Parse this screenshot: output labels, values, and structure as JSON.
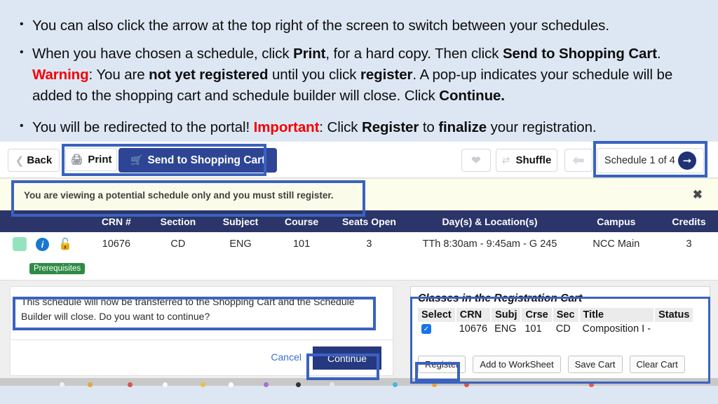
{
  "slide": {
    "background": "#dde7f3",
    "bullets": [
      {
        "id": "b1",
        "parts": [
          {
            "t": "You can also click the arrow at the top right of the screen to switch between your schedules.",
            "s": "normal"
          }
        ]
      },
      {
        "id": "b2",
        "parts": [
          {
            "t": "When you have chosen a schedule, click ",
            "s": "normal"
          },
          {
            "t": "Print",
            "s": "bold"
          },
          {
            "t": ", for a hard copy.  Then click ",
            "s": "normal"
          },
          {
            "t": "Send to Shopping Cart",
            "s": "bold"
          },
          {
            "t": ".  ",
            "s": "normal"
          },
          {
            "t": "Warning",
            "s": "red"
          },
          {
            "t": ": You are ",
            "s": "normal"
          },
          {
            "t": "not yet registered",
            "s": "bold"
          },
          {
            "t": " until you click ",
            "s": "normal"
          },
          {
            "t": "register",
            "s": "bold"
          },
          {
            "t": ".  A pop-up indicates your schedule will be added to the shopping cart and schedule builder will close. Click ",
            "s": "normal"
          },
          {
            "t": "Continue.",
            "s": "bold"
          }
        ]
      },
      {
        "id": "b3",
        "parts": [
          {
            "t": "You will be redirected to the portal!  ",
            "s": "normal"
          },
          {
            "t": "Important",
            "s": "red"
          },
          {
            "t": ":  Click ",
            "s": "normal"
          },
          {
            "t": "Register",
            "s": "bold"
          },
          {
            "t": " to ",
            "s": "normal"
          },
          {
            "t": "finalize",
            "s": "bold"
          },
          {
            "t": " your registration.",
            "s": "normal"
          }
        ]
      }
    ]
  },
  "toolbar": {
    "back_label": "Back",
    "back_icon": "chevron-left-icon",
    "print_label": "Print",
    "print_icon": "printer-icon",
    "cart_label": "Send to Shopping Cart",
    "cart_icon": "shopping-cart-icon",
    "favorite_icon": "heart-icon",
    "shuffle_label": "Shuffle",
    "shuffle_icon": "shuffle-icon",
    "prev_icon": "arrow-left-circle-icon",
    "schedule_label": "Schedule 1 of 4",
    "next_icon": "arrow-right-circle-icon",
    "cart_button_color": "#2e4595",
    "next_circle_color": "#1f3373"
  },
  "alert": {
    "text": "You are viewing a potential schedule only and you must still register.",
    "close_icon": "close-icon",
    "background": "#fdfdec"
  },
  "schedule_table": {
    "headers": [
      "",
      "CRN #",
      "Section",
      "Subject",
      "Course",
      "Seats Open",
      "Day(s) & Location(s)",
      "Campus",
      "Credits"
    ],
    "header_background": "#2b3569",
    "rows": [
      {
        "status_icon": "color-swatch-icon",
        "info_icon": "info-icon",
        "lock_icon": "unlock-icon",
        "crn": "10676",
        "section": "CD",
        "subject": "ENG",
        "course": "101",
        "seats_open": "3",
        "day_location": "TTh 8:30am - 9:45am - G 245",
        "campus": "NCC Main",
        "credits": "3",
        "badge": "Prerequisites",
        "badge_color": "#2e8b45"
      }
    ]
  },
  "dialog": {
    "message": "This schedule will now be transferred to the Shopping Cart and the Schedule Builder will close. Do you want to continue?",
    "cancel_label": "Cancel",
    "continue_label": "Continue",
    "continue_color": "#26387f"
  },
  "registration_cart": {
    "title": "Classes in the Registration Cart",
    "headers": [
      "Select",
      "CRN",
      "Subj",
      "Crse",
      "Sec",
      "Title",
      "Status"
    ],
    "rows": [
      {
        "selected": true,
        "check_icon": "checkmark-icon",
        "crn": "10676",
        "subj": "ENG",
        "crse": "101",
        "sec": "CD",
        "title": "Composition I -",
        "status": ""
      }
    ],
    "buttons": [
      "Register",
      "Add to WorkSheet",
      "Save Cart",
      "Clear Cart"
    ]
  },
  "annotations": {
    "highlight_color": "#3a62bf",
    "boxes": [
      "print-and-cart",
      "schedule-pager",
      "alert-banner",
      "dialog-message",
      "continue-button",
      "register-button",
      "registration-cart"
    ]
  }
}
